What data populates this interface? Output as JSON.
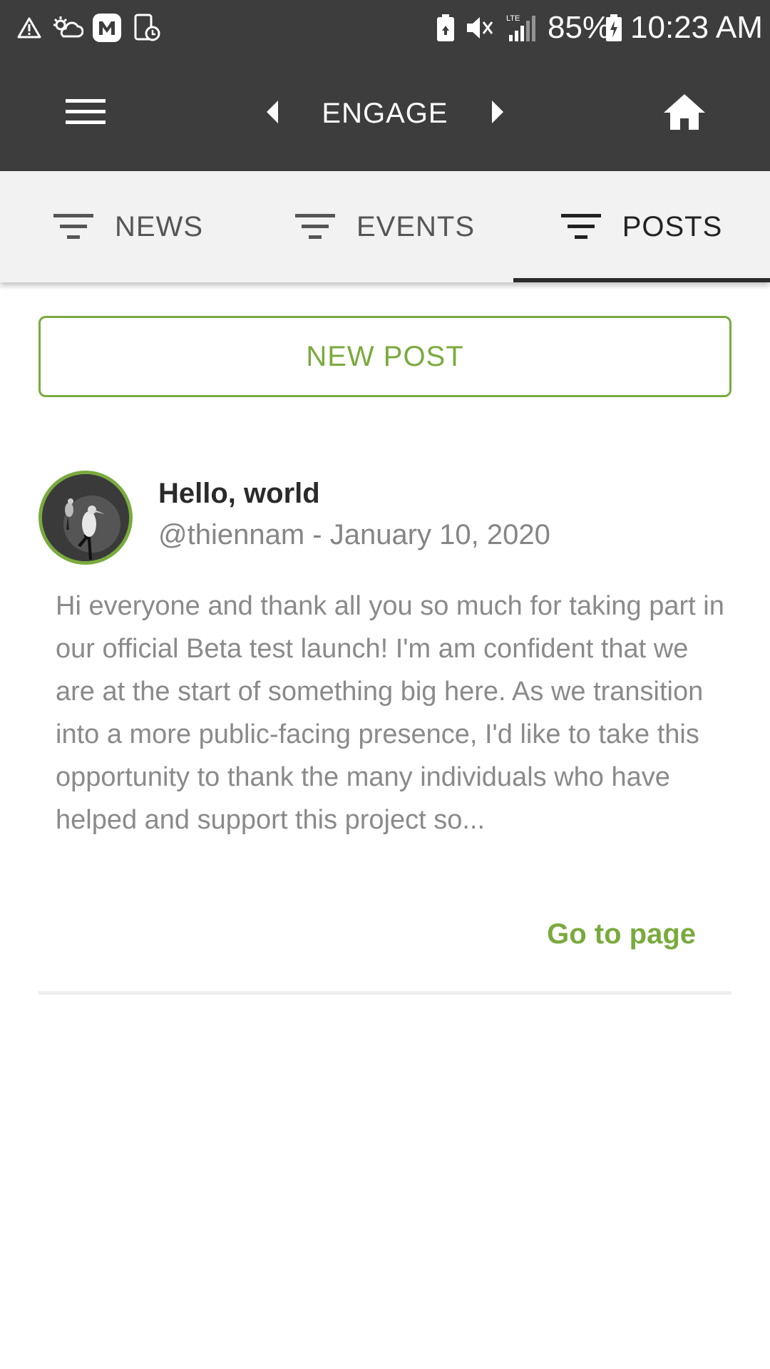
{
  "status_bar": {
    "battery_percent": "85%",
    "time": "10:23 AM",
    "network_label": "LTE",
    "icons": [
      "warning-icon",
      "weather-icon",
      "app-m-icon",
      "phone-clock-icon",
      "battery-saver-icon",
      "mute-icon",
      "signal-icon",
      "battery-charging-icon"
    ]
  },
  "app_bar": {
    "title": "ENGAGE",
    "menu_icon": "hamburger-menu-icon",
    "prev_icon": "caret-left-icon",
    "next_icon": "caret-right-icon",
    "home_icon": "home-icon"
  },
  "tabs": [
    {
      "label": "NEWS",
      "icon": "filter-icon",
      "active": false
    },
    {
      "label": "EVENTS",
      "icon": "filter-icon",
      "active": false
    },
    {
      "label": "POSTS",
      "icon": "filter-icon",
      "active": true
    }
  ],
  "new_post_button": {
    "label": "NEW POST"
  },
  "post": {
    "title": "Hello, world",
    "meta": "@thiennam - January 10, 2020",
    "body": "Hi everyone and thank all you so much for taking part in our official Beta test launch! I'm am confident that we are at the start of something big here. As we transition into a more public-facing presence, I'd like to take this opportunity to thank the many individuals who have helped and support this project so...",
    "link_label": "Go to page"
  },
  "colors": {
    "header_bg": "#3d3d3d",
    "tab_bg": "#f2f2f2",
    "accent": "#7aaa3e",
    "body_text": "#8a8a8a",
    "title_text": "#2a2a2a"
  }
}
